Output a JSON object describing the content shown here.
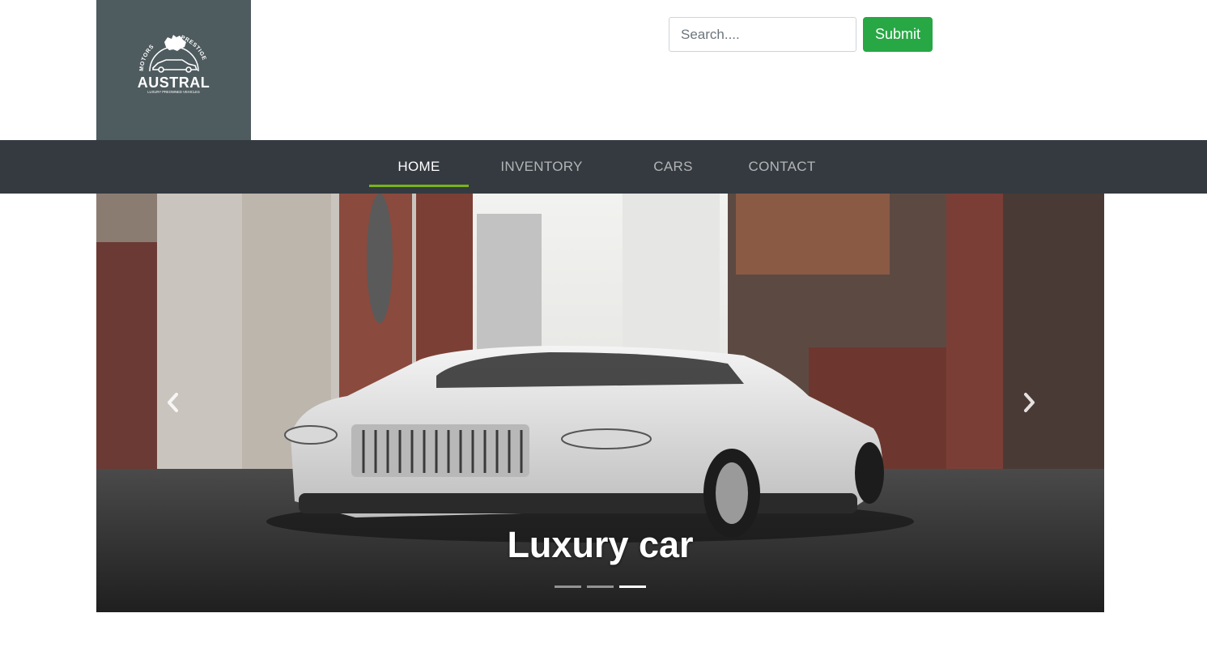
{
  "brand": {
    "logo_arc_left": "MOTORS",
    "logo_arc_right": "PRESTIGE",
    "logo_name": "AUSTRAL",
    "logo_tagline": "LUXURY PREOWNED VEHICLES",
    "bg_color": "#4e5b5f"
  },
  "search": {
    "placeholder": "Search....",
    "value": "",
    "submit_label": "Submit",
    "submit_color": "#28a745"
  },
  "nav": {
    "items": [
      {
        "label": "HOME",
        "active": true
      },
      {
        "label": "INVENTORY",
        "active": false
      },
      {
        "label": "CARS",
        "active": false
      },
      {
        "label": "CONTACT",
        "active": false
      }
    ],
    "bg_color": "#343a40",
    "active_underline_color": "#7ab317"
  },
  "carousel": {
    "caption": "Luxury car",
    "slide_count": 3,
    "active_slide": 3,
    "prev_icon": "chevron-left-icon",
    "next_icon": "chevron-right-icon"
  }
}
